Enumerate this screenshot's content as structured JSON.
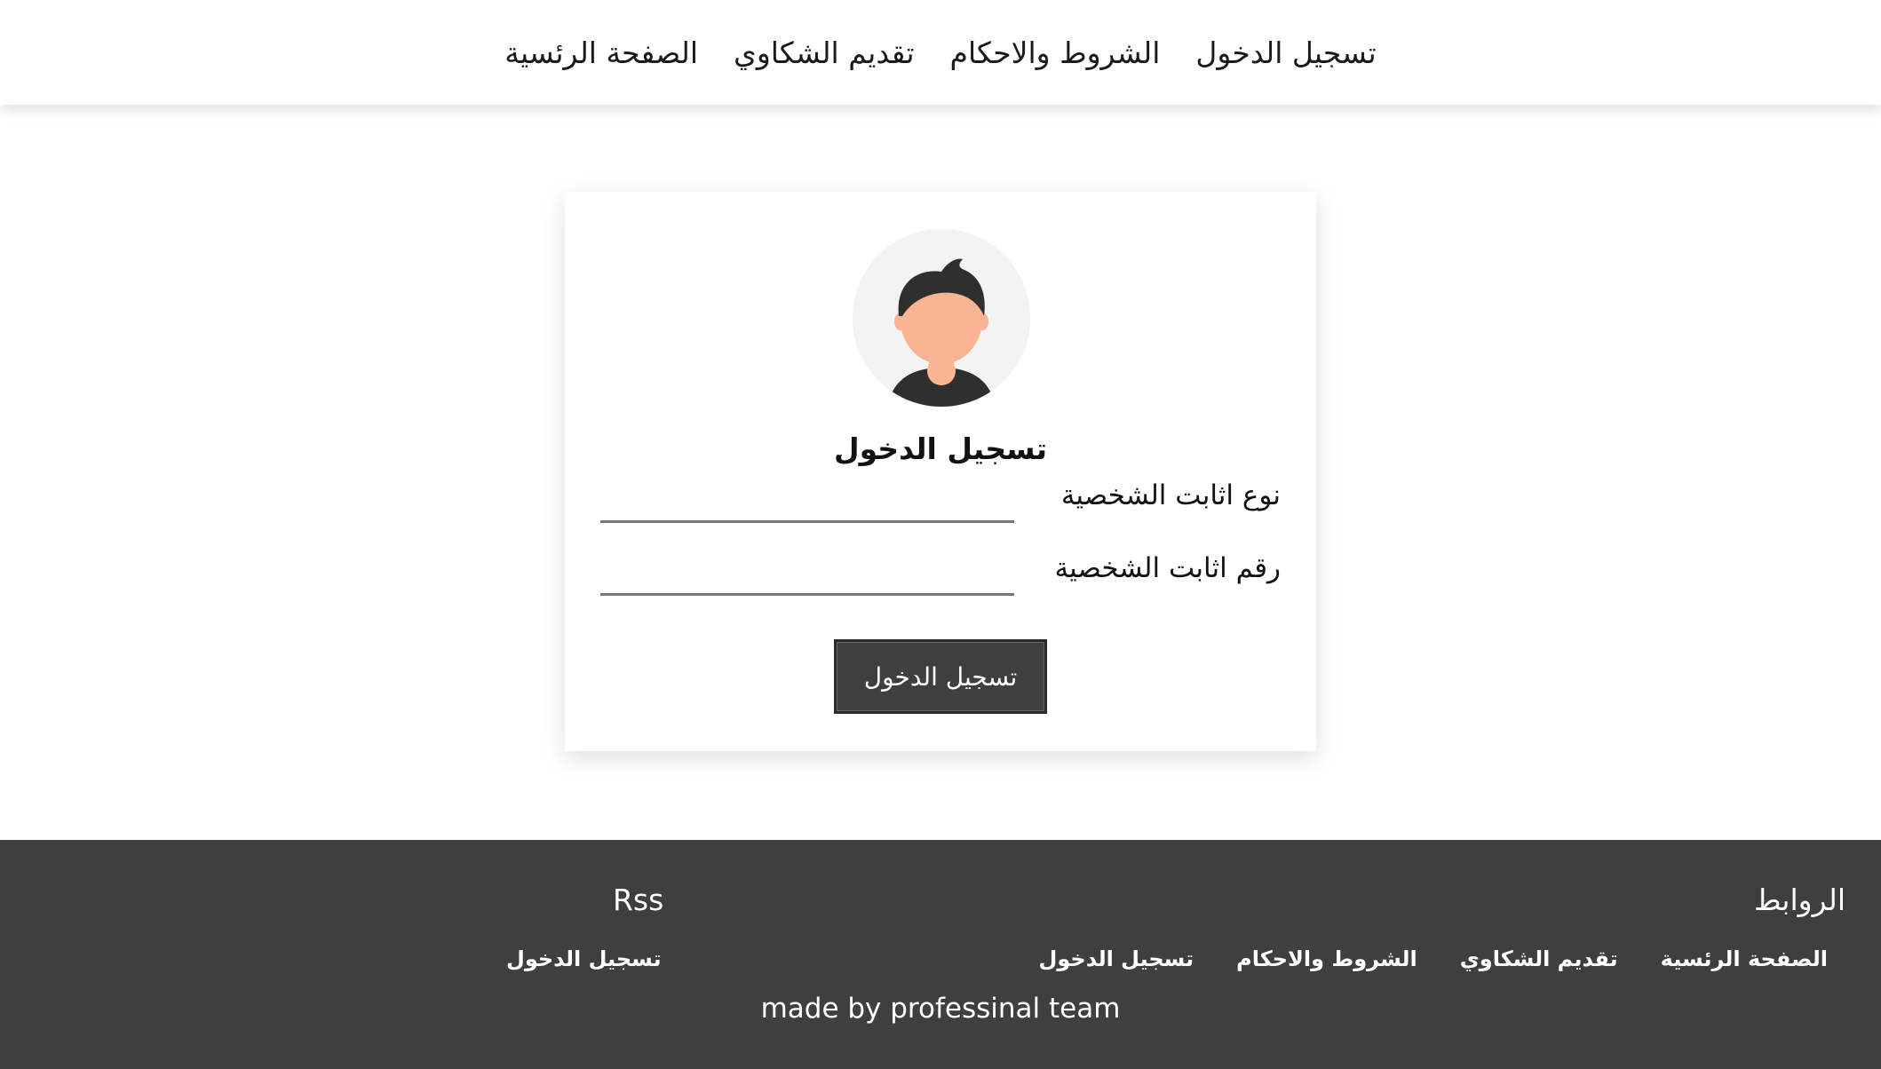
{
  "nav": {
    "items": [
      {
        "label": "الصفحة الرئسية"
      },
      {
        "label": "تقديم الشكاوي"
      },
      {
        "label": "الشروط والاحكام"
      },
      {
        "label": "تسجيل الدخول"
      }
    ]
  },
  "login": {
    "title": "تسجيل الدخول",
    "fields": [
      {
        "label": "نوع اثابت الشخصية",
        "value": ""
      },
      {
        "label": "رقم اثابت الشخصية",
        "value": ""
      }
    ],
    "submit_label": "تسجيل الدخول"
  },
  "footer": {
    "links_heading": "الروابط",
    "links": [
      {
        "label": "الصفحة الرئسية"
      },
      {
        "label": "تقديم الشكاوي"
      },
      {
        "label": "الشروط والاحكام"
      },
      {
        "label": "تسجيل الدخول"
      }
    ],
    "rss_heading": "Rss",
    "rss_link": "تسجيل الدخول",
    "credit": "made by professinal team"
  },
  "colors": {
    "footer_bg": "#3f3f3f",
    "button_bg": "#3f3f3f",
    "avatar_bg": "#f3f3f3",
    "skin": "#f9b592",
    "hair": "#2f2f2f"
  },
  "icons": {
    "avatar": "user-avatar-icon"
  }
}
